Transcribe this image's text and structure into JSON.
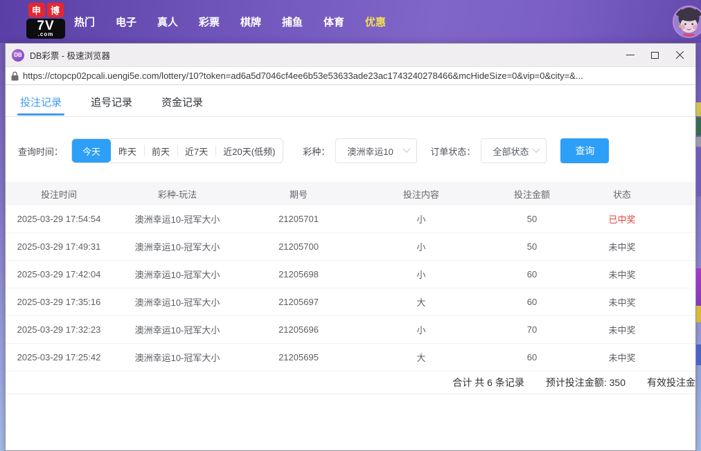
{
  "site_nav": {
    "logo": {
      "badge_left": "申",
      "badge_right": "博",
      "brand": "7V",
      "domain": ".com"
    },
    "items": [
      {
        "label": "热门",
        "highlight": false
      },
      {
        "label": "电子",
        "highlight": false
      },
      {
        "label": "真人",
        "highlight": false
      },
      {
        "label": "彩票",
        "highlight": false
      },
      {
        "label": "棋牌",
        "highlight": false
      },
      {
        "label": "捕鱼",
        "highlight": false
      },
      {
        "label": "体育",
        "highlight": false
      },
      {
        "label": "优惠",
        "highlight": true
      }
    ]
  },
  "browser": {
    "favicon_text": "DB",
    "title": "DB彩票 - 极速浏览器",
    "url": "https://ctopcp02pcali.uengi5e.com/lottery/10?token=ad6a5d7046cf4ee6b53e53633ade23ac1743240278466&mcHideSize=0&vip=0&city=&..."
  },
  "tabs": [
    {
      "label": "投注记录",
      "active": true
    },
    {
      "label": "追号记录",
      "active": false
    },
    {
      "label": "资金记录",
      "active": false
    }
  ],
  "filters": {
    "time_label": "查询时间：",
    "time_options": [
      "今天",
      "昨天",
      "前天",
      "近7天",
      "近20天(低频)"
    ],
    "time_active_index": 0,
    "lottery_label": "彩种：",
    "lottery_value": "澳洲幸运10",
    "status_label": "订单状态：",
    "status_value": "全部状态",
    "search_label": "查询"
  },
  "table": {
    "headers": [
      "投注时间",
      "彩种-玩法",
      "期号",
      "投注内容",
      "投注金额",
      "状态"
    ],
    "rows": [
      {
        "time": "2025-03-29 17:54:54",
        "game": "澳洲幸运10-冠军大小",
        "issue": "21205701",
        "content": "小",
        "amount": "50",
        "status": "已中奖",
        "won": true
      },
      {
        "time": "2025-03-29 17:49:31",
        "game": "澳洲幸运10-冠军大小",
        "issue": "21205700",
        "content": "小",
        "amount": "50",
        "status": "未中奖",
        "won": false
      },
      {
        "time": "2025-03-29 17:42:04",
        "game": "澳洲幸运10-冠军大小",
        "issue": "21205698",
        "content": "小",
        "amount": "60",
        "status": "未中奖",
        "won": false
      },
      {
        "time": "2025-03-29 17:35:16",
        "game": "澳洲幸运10-冠军大小",
        "issue": "21205697",
        "content": "大",
        "amount": "60",
        "status": "未中奖",
        "won": false
      },
      {
        "time": "2025-03-29 17:32:23",
        "game": "澳洲幸运10-冠军大小",
        "issue": "21205696",
        "content": "小",
        "amount": "70",
        "status": "未中奖",
        "won": false
      },
      {
        "time": "2025-03-29 17:25:42",
        "game": "澳洲幸运10-冠军大小",
        "issue": "21205695",
        "content": "大",
        "amount": "60",
        "status": "未中奖",
        "won": false
      }
    ]
  },
  "summary": {
    "total": "合计 共 6 条记录",
    "expected": "预计投注金额: 350",
    "valid": "有效投注金"
  },
  "colors": {
    "accent_blue": "#2d9ff7",
    "tab_blue": "#3d9bf0",
    "won_red": "#e8403c",
    "nav_highlight": "#f3df4e"
  }
}
